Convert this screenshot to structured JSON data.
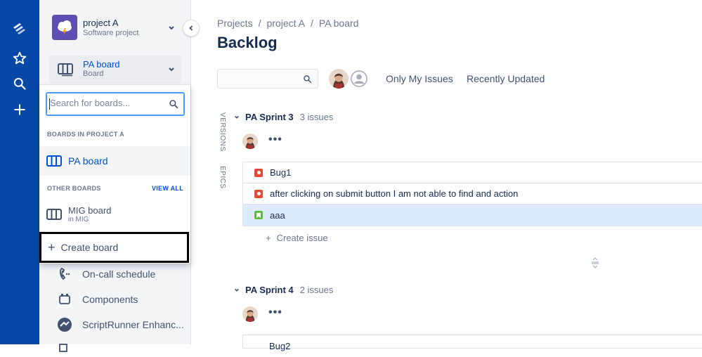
{
  "rail": {
    "icons": [
      "jira-logo-icon",
      "star-icon",
      "search-icon",
      "plus-icon"
    ]
  },
  "sidebar": {
    "project_name": "project A",
    "project_type": "Software project",
    "board_name": "PA board",
    "board_sub": "Board",
    "items": [
      {
        "label": "On-call schedule",
        "icon": "phone-icon"
      },
      {
        "label": "Components",
        "icon": "components-icon"
      },
      {
        "label": "ScriptRunner Enhanc...",
        "icon": "scriptrunner-icon"
      }
    ]
  },
  "dropdown": {
    "search_placeholder": "Search for boards...",
    "section_project": "BOARDS IN PROJECT A",
    "project_boards": [
      {
        "name": "PA board"
      }
    ],
    "section_other": "OTHER BOARDS",
    "view_all": "VIEW ALL",
    "other_boards": [
      {
        "name": "MIG board",
        "sub": "in MIG"
      }
    ],
    "create_label": "Create board"
  },
  "main": {
    "breadcrumb": [
      "Projects",
      "/",
      "project A",
      "/",
      "PA board"
    ],
    "title": "Backlog",
    "filters": [
      "Only My Issues",
      "Recently Updated"
    ],
    "side_tabs": [
      "VERSIONS",
      "EPICS"
    ],
    "sprints": [
      {
        "name": "PA Sprint 3",
        "count": "3 issues",
        "issues": [
          {
            "type": "bug",
            "summary": "Bug1"
          },
          {
            "type": "bug",
            "summary": "after clicking on submit button I am not able to find and action"
          },
          {
            "type": "story",
            "summary": "aaa"
          }
        ],
        "create_issue": "Create issue"
      },
      {
        "name": "PA Sprint 4",
        "count": "2 issues",
        "first_issue_partial": "Bug2"
      }
    ],
    "more_label": "•••",
    "create_plus": "+"
  },
  "colors": {
    "rail": "#0747a6",
    "bug": "#e5493a",
    "story": "#63ba3c",
    "link": "#0052cc",
    "selected_row": "#deebff"
  }
}
